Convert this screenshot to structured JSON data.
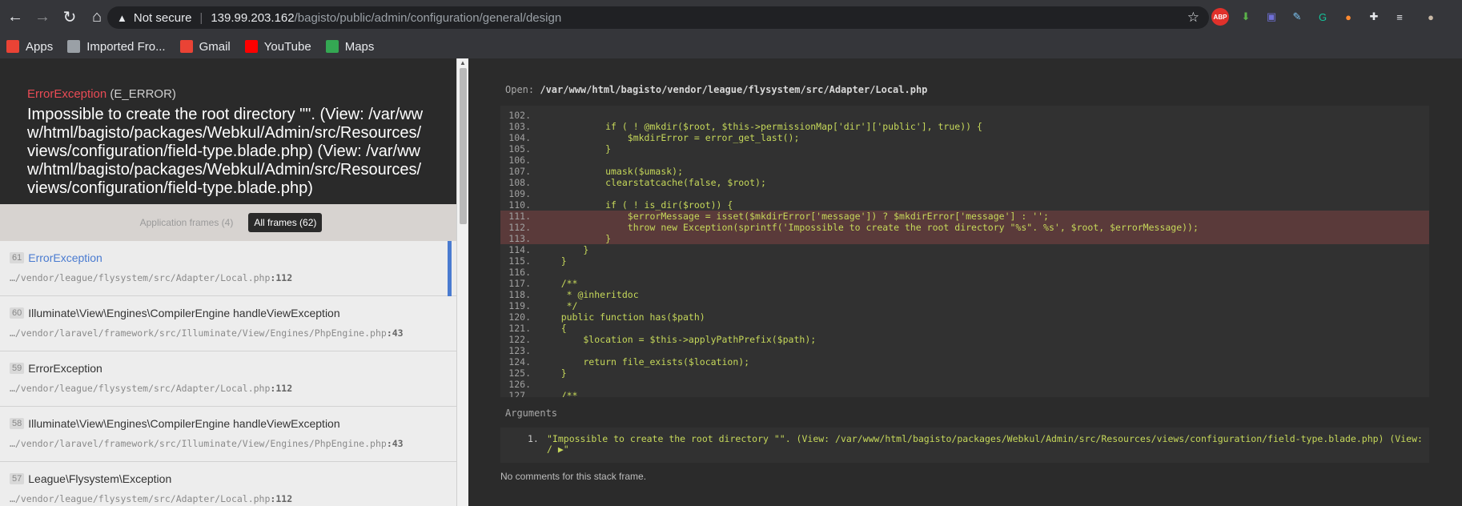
{
  "browser": {
    "security_label": "Not secure",
    "url_host": "139.99.203.162",
    "url_path": "/bagisto/public/admin/configuration/general/design",
    "bookmarks": [
      {
        "label": "Apps",
        "icon": "apps-grid-icon",
        "color": "#ea4335"
      },
      {
        "label": "Imported Fro...",
        "icon": "folder-icon",
        "color": "#9aa0a6"
      },
      {
        "label": "Gmail",
        "icon": "gmail-icon",
        "color": "#ea4335"
      },
      {
        "label": "YouTube",
        "icon": "youtube-icon",
        "color": "#ff0000"
      },
      {
        "label": "Maps",
        "icon": "maps-icon",
        "color": "#34a853"
      }
    ],
    "extensions": [
      {
        "name": "abp-icon",
        "text": "ABP",
        "color": "#e0312b"
      },
      {
        "name": "download-icon",
        "text": "⬇",
        "color": "#5bb34a"
      },
      {
        "name": "screen-icon",
        "text": "▣",
        "color": "#6f6fd6"
      },
      {
        "name": "eyedropper-icon",
        "text": "✎",
        "color": "#7dc4f2"
      },
      {
        "name": "grammarly-icon",
        "text": "G",
        "color": "#15c39a"
      },
      {
        "name": "flame-icon",
        "text": "●",
        "color": "#ff8a30"
      },
      {
        "name": "puzzle-icon",
        "text": "✚",
        "color": "#e8eaed"
      },
      {
        "name": "queue-icon",
        "text": "≡",
        "color": "#e8eaed"
      },
      {
        "name": "profile-avatar-icon",
        "text": "●",
        "color": "#c9b9a6"
      }
    ]
  },
  "error": {
    "class": "ErrorException",
    "type": "(E_ERROR)",
    "message": "Impossible to create the root directory \"\". (View: /var/www/html/bagisto/packages/Webkul/Admin/src/Resources/views/configuration/field-type.blade.php) (View: /var/www/html/bagisto/packages/Webkul/Admin/src/Resources/views/configuration/field-type.blade.php)"
  },
  "filters": {
    "application": "Application frames (4)",
    "all": "All frames (62)"
  },
  "frames": [
    {
      "index": "61",
      "class": "ErrorException",
      "file": "…/vendor/league/flysystem/src/Adapter/Local.php",
      "line": ":112",
      "active": true
    },
    {
      "index": "60",
      "class": "Illuminate\\View\\Engines\\CompilerEngine handleViewException",
      "file": "…/vendor/laravel/framework/src/Illuminate/View/Engines/PhpEngine.php",
      "line": ":43",
      "active": false
    },
    {
      "index": "59",
      "class": "ErrorException",
      "file": "…/vendor/league/flysystem/src/Adapter/Local.php",
      "line": ":112",
      "active": false
    },
    {
      "index": "58",
      "class": "Illuminate\\View\\Engines\\CompilerEngine handleViewException",
      "file": "…/vendor/laravel/framework/src/Illuminate/View/Engines/PhpEngine.php",
      "line": ":43",
      "active": false
    },
    {
      "index": "57",
      "class": "League\\Flysystem\\Exception",
      "file": "…/vendor/league/flysystem/src/Adapter/Local.php",
      "line": ":112",
      "active": false
    }
  ],
  "editor": {
    "open_label": "Open:",
    "open_path": "/var/www/html/bagisto/vendor/league/flysystem/src/Adapter/Local.php",
    "lines": [
      {
        "n": "102.",
        "t": "",
        "hl": false
      },
      {
        "n": "103.",
        "t": "            if ( ! @mkdir($root, $this->permissionMap['dir']['public'], true)) {",
        "hl": false
      },
      {
        "n": "104.",
        "t": "                $mkdirError = error_get_last();",
        "hl": false
      },
      {
        "n": "105.",
        "t": "            }",
        "hl": false
      },
      {
        "n": "106.",
        "t": "",
        "hl": false
      },
      {
        "n": "107.",
        "t": "            umask($umask);",
        "hl": false
      },
      {
        "n": "108.",
        "t": "            clearstatcache(false, $root);",
        "hl": false
      },
      {
        "n": "109.",
        "t": "",
        "hl": false
      },
      {
        "n": "110.",
        "t": "            if ( ! is_dir($root)) {",
        "hl": false
      },
      {
        "n": "111.",
        "t": "                $errorMessage = isset($mkdirError['message']) ? $mkdirError['message'] : '';",
        "hl": true
      },
      {
        "n": "112.",
        "t": "                throw new Exception(sprintf('Impossible to create the root directory \"%s\". %s', $root, $errorMessage));",
        "hl": true
      },
      {
        "n": "113.",
        "t": "            }",
        "hl": true
      },
      {
        "n": "114.",
        "t": "        }",
        "hl": false
      },
      {
        "n": "115.",
        "t": "    }",
        "hl": false
      },
      {
        "n": "116.",
        "t": "",
        "hl": false
      },
      {
        "n": "117.",
        "t": "    /**",
        "hl": false
      },
      {
        "n": "118.",
        "t": "     * @inheritdoc",
        "hl": false
      },
      {
        "n": "119.",
        "t": "     */",
        "hl": false
      },
      {
        "n": "120.",
        "t": "    public function has($path)",
        "hl": false
      },
      {
        "n": "121.",
        "t": "    {",
        "hl": false
      },
      {
        "n": "122.",
        "t": "        $location = $this->applyPathPrefix($path);",
        "hl": false
      },
      {
        "n": "123.",
        "t": "",
        "hl": false
      },
      {
        "n": "124.",
        "t": "        return file_exists($location);",
        "hl": false
      },
      {
        "n": "125.",
        "t": "    }",
        "hl": false
      },
      {
        "n": "126.",
        "t": "",
        "hl": false
      },
      {
        "n": "127.",
        "t": "    /**",
        "hl": false
      }
    ]
  },
  "arguments": {
    "label": "Arguments",
    "number": "1.",
    "value": "\"Impossible to create the root directory \"\".  (View: /var/www/html/bagisto/packages/Webkul/Admin/src/Resources/views/configuration/field-type.blade.php) (View: / ▶\""
  },
  "comments": "No comments for this stack frame."
}
